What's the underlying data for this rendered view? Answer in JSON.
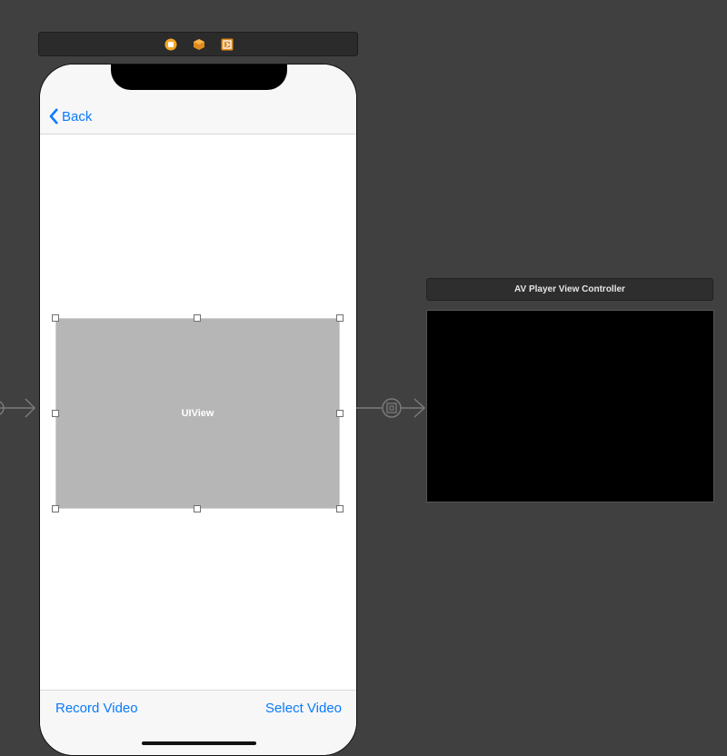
{
  "dock": {
    "icons": [
      "view-controller-icon",
      "first-responder-icon",
      "exit-icon"
    ],
    "accent": "#f5a623"
  },
  "phone": {
    "nav": {
      "back_label": "Back"
    },
    "content": {
      "uiview_label": "UIView"
    },
    "toolbar": {
      "left_label": "Record Video",
      "right_label": "Select Video"
    },
    "tint": "#0a7aff"
  },
  "av_player": {
    "title": "AV Player View Controller"
  },
  "colors": {
    "canvas": "#404040",
    "uiview_fill": "#b6b6b6"
  }
}
